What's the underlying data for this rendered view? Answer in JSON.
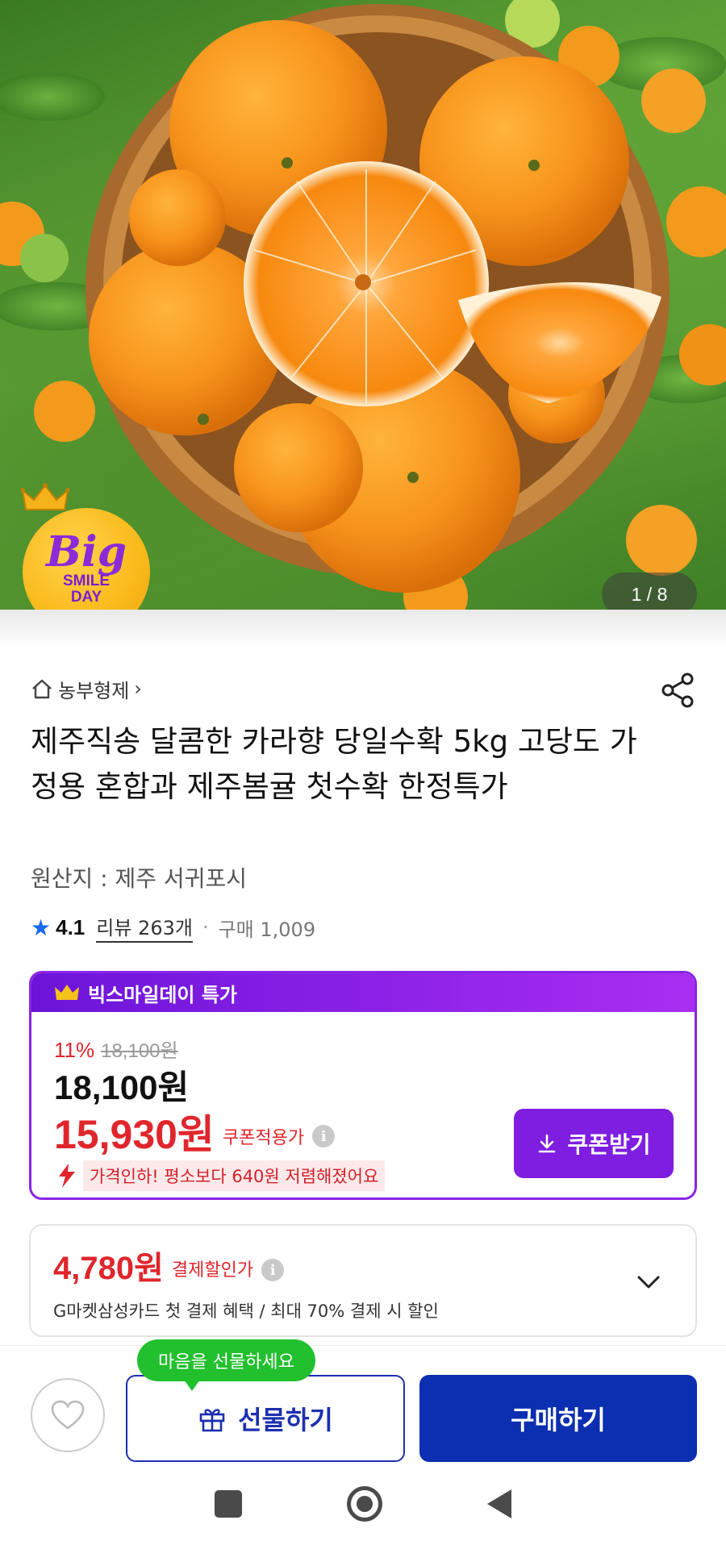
{
  "hero": {
    "badge": {
      "word": "Big",
      "line1": "SMILE",
      "line2": "DAY"
    },
    "page_counter": "1 / 8"
  },
  "product": {
    "store_name": "농부형제",
    "store_chevron": "›",
    "title": "제주직송 달콤한 카라향 당일수확 5kg 고당도 가정용 혼합과 제주봄귤 첫수확 한정특가",
    "origin": "원산지 : 제주 서귀포시",
    "rating": "4.1",
    "review_label": "리뷰 263개",
    "separator": "·",
    "purchase_label": "구매 1,009"
  },
  "price_card": {
    "header_label": "빅스마일데이 특가",
    "discount_rate": "11%",
    "original_price": "18,100원",
    "sale_price": "18,100원",
    "coupon_price": "15,930원",
    "coupon_price_label": "쿠폰적용가",
    "price_drop_text": "가격인하! 평소보다 640원 저렴해졌어요",
    "coupon_button_label": "쿠폰받기"
  },
  "payment_card": {
    "price": "4,780원",
    "label": "결제할인가",
    "description": "G마켓삼성카드 첫 결제 혜택 / 최대 70% 결제 시 할인"
  },
  "action_bar": {
    "gift_tooltip": "마음을 선물하세요",
    "gift_label": "선물하기",
    "buy_label": "구매하기"
  },
  "colors": {
    "accent_purple": "#8a24e6",
    "price_red": "#e0262c",
    "brand_blue": "#0b2fb0",
    "tooltip_green": "#22c02e"
  },
  "icons": [
    "home-icon",
    "share-icon",
    "star-icon",
    "crown-icon",
    "info-icon",
    "download-icon",
    "chevron-down-icon",
    "heart-icon",
    "gift-icon",
    "price-drop-icon"
  ]
}
